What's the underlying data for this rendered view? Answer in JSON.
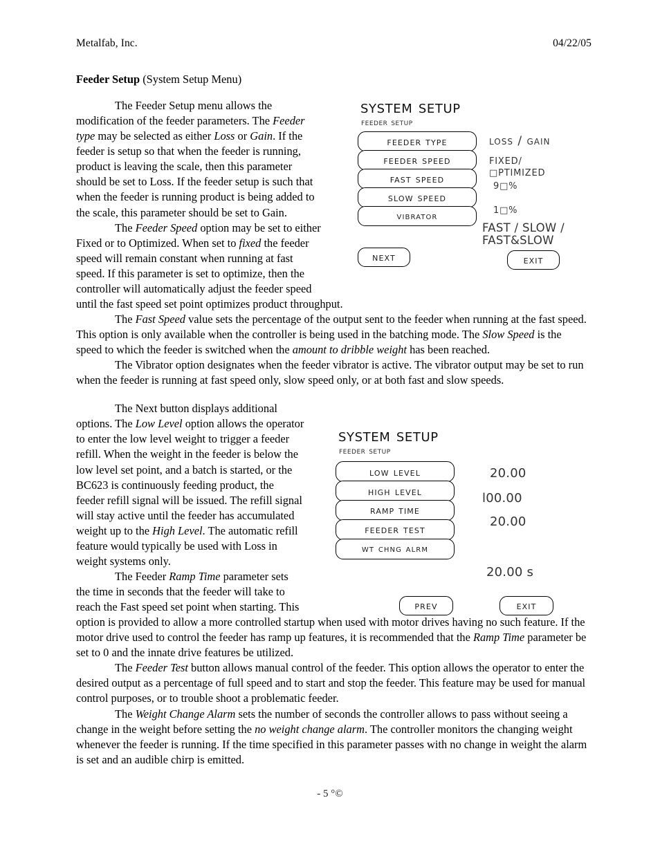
{
  "header": {
    "company": "Metalfab,  Inc.",
    "date": "04/22/05"
  },
  "section": {
    "title_bold": "Feeder Setup",
    "title_rest": " (System Setup Menu)"
  },
  "paragraphs": {
    "p1_a": "The Feeder Setup menu allows the modification of the feeder parameters.  The ",
    "p1_i1": "Feeder type",
    "p1_b": " may be selected as either ",
    "p1_i2": "Loss",
    "p1_c": " or ",
    "p1_i3": "Gain",
    "p1_d": ".  If the feeder is setup so that when the feeder is running, product is leaving the scale, then this parameter should be set to Loss.  If the feeder setup is such that when the feeder is running product is being added to the scale, this parameter should be set to Gain.",
    "p2_a": "The ",
    "p2_i1": "Feeder Speed",
    "p2_b": " option may be set to either Fixed or to Optimized.  When set to ",
    "p2_i2": "fixed",
    "p2_c": " the feeder speed will remain constant when running at fast speed.  If this parameter is set to optimize, then the controller will automatically adjust the feeder speed until the fast speed set point optimizes product throughput.",
    "p3_a": "The ",
    "p3_i1": "Fast Speed",
    "p3_b": " value sets the percentage of the output sent to the feeder when running at the fast speed.  This option is only available when the controller is being used in the batching mode.  The ",
    "p3_i2": "Slow Speed",
    "p3_c": " is the speed to which the feeder is switched when the ",
    "p3_i3": "amount to dribble weight",
    "p3_d": " has been reached.",
    "p4": "The Vibrator option designates when the feeder vibrator is active.  The vibrator output may be set to run when the feeder is running at fast speed only, slow speed only, or at both fast and slow speeds.",
    "p5_a": "The Next button displays additional options. The ",
    "p5_i1": "Low Level",
    "p5_b": " option allows the operator to enter the low level weight to trigger a feeder refill. When the weight in the feeder is below the low level set point, and a batch is started, or the BC623 is continuously feeding product, the feeder refill signal will be issued.  The refill signal will stay active until the feeder has accumulated weight up to the ",
    "p5_i2": "High Level",
    "p5_c": ". The automatic refill feature would typically be used with Loss in weight systems only.",
    "p6_a": "The Feeder ",
    "p6_i1": "Ramp Time",
    "p6_b": " parameter sets the time in seconds that the feeder will take to reach the Fast speed set point when starting. This option is provided to allow a more controlled startup when used with motor drives having no such feature.  If the motor drive used to control the feeder has ramp up features, it is recommended that the ",
    "p6_i2": "Ramp Time",
    "p6_c": " parameter be set to 0 and the innate drive features be utilized.",
    "p7_a": "The ",
    "p7_i1": "Feeder Test",
    "p7_b": " button allows manual control of the feeder. This option allows the operator to enter the desired output as a percentage of full speed and to start and stop the feeder. This feature may be used for manual control purposes, or to trouble shoot a problematic feeder.",
    "p8_a": "The ",
    "p8_i1": "Weight Change Alarm",
    "p8_b": " sets the number of seconds the controller allows to pass without seeing a change in the weight before setting the ",
    "p8_i2": "no weight change alarm",
    "p8_c": ".  The controller monitors the changing weight whenever the feeder is running. If the time specified in this parameter passes with no change in weight the alarm is set and an audible chirp is emitted."
  },
  "panel1": {
    "title": "System Setup",
    "subtitle": "Feeder Setup",
    "buttons": [
      {
        "label": "Feeder Type"
      },
      {
        "label": "Feeder Speed"
      },
      {
        "label": "Fast Speed"
      },
      {
        "label": "Slow Speed"
      },
      {
        "label": "Vibrator"
      }
    ],
    "values": {
      "feeder_type": "Loss / Gain",
      "feeder_speed_l1": "FIXED/",
      "feeder_speed_l2": "□PTIMIZED",
      "fast_speed": "9□%",
      "slow_speed": "1□%",
      "vibrator_l1": "FAST / SLOW /",
      "vibrator_l2": "FAST&SLOW"
    },
    "nav": {
      "next": "Next",
      "exit": "Exit"
    }
  },
  "panel2": {
    "title": "System Setup",
    "subtitle": "Feeder Setup",
    "buttons": [
      {
        "label": "Low Level"
      },
      {
        "label": "High Level"
      },
      {
        "label": "Ramp Time"
      },
      {
        "label": "Feeder Test"
      },
      {
        "label": "Wt Chng Alrm"
      }
    ],
    "values": {
      "low_level": "20.00",
      "high_level": "l00.00",
      "ramp_time": "20.00",
      "wt_chng_alrm": "20.00 s"
    },
    "nav": {
      "prev": "Prev",
      "exit": "Exit"
    }
  },
  "footer": {
    "page": "- 5 °©"
  }
}
